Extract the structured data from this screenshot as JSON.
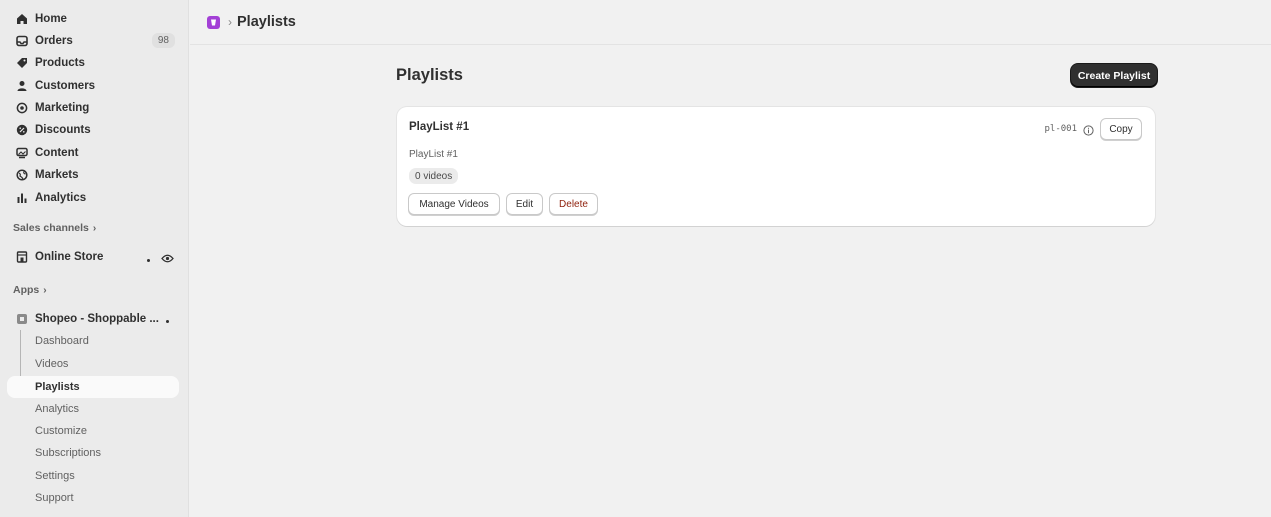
{
  "sidebar": {
    "nav": [
      {
        "label": "Home",
        "icon": "home-icon"
      },
      {
        "label": "Orders",
        "icon": "inbox-icon",
        "badge": "98"
      },
      {
        "label": "Products",
        "icon": "tag-icon"
      },
      {
        "label": "Customers",
        "icon": "person-icon"
      },
      {
        "label": "Marketing",
        "icon": "target-icon"
      },
      {
        "label": "Discounts",
        "icon": "discount-icon"
      },
      {
        "label": "Content",
        "icon": "content-icon"
      },
      {
        "label": "Markets",
        "icon": "globe-icon"
      },
      {
        "label": "Analytics",
        "icon": "bar-chart-icon"
      }
    ],
    "sales_channels_label": "Sales channels",
    "online_store_label": "Online Store",
    "apps_label": "Apps",
    "app_name": "Shopeo - Shoppable ...",
    "app_sub_items": [
      {
        "label": "Dashboard"
      },
      {
        "label": "Videos"
      },
      {
        "label": "Playlists",
        "active": true
      },
      {
        "label": "Analytics"
      },
      {
        "label": "Customize"
      },
      {
        "label": "Subscriptions"
      },
      {
        "label": "Settings"
      },
      {
        "label": "Support"
      }
    ]
  },
  "topbar": {
    "crumb_separator": "›",
    "title": "Playlists"
  },
  "main": {
    "page_title": "Playlists",
    "create_button": "Create Playlist",
    "playlist_card": {
      "title": "PlayList #1",
      "description": "PlayList #1",
      "video_count": "0 videos",
      "id_code": "pl-001",
      "copy_label": "Copy",
      "manage_label": "Manage Videos",
      "edit_label": "Edit",
      "delete_label": "Delete"
    }
  },
  "colors": {
    "accent": "#303030",
    "app_logo": "#a340d6",
    "danger_text": "#8e1f0b"
  }
}
